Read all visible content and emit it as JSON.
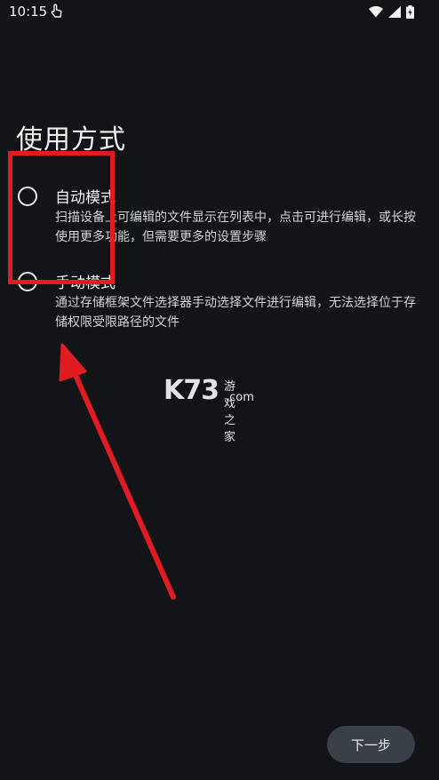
{
  "status_bar": {
    "time": "10:15",
    "icons": [
      "touch-icon",
      "wifi-icon",
      "signal-icon",
      "battery-charging-icon"
    ]
  },
  "page": {
    "title": "使用方式"
  },
  "options": [
    {
      "label": "自动模式",
      "description": "扫描设备上可编辑的文件显示在列表中，点击可进行编辑，或长按使用更多功能，但需要更多的设置步骤",
      "selected": false
    },
    {
      "label": "手动模式",
      "description": "通过存储框架文件选择器手动选择文件进行编辑，无法选择位于存储权限受限路径的文件",
      "selected": false
    }
  ],
  "watermark": {
    "brand": "K73",
    "text": "游戏之家",
    "domain": ".com"
  },
  "footer": {
    "next_label": "下一步"
  },
  "colors": {
    "background": "#121417",
    "annotation": "#e11b22",
    "button_bg": "#3a4048"
  }
}
